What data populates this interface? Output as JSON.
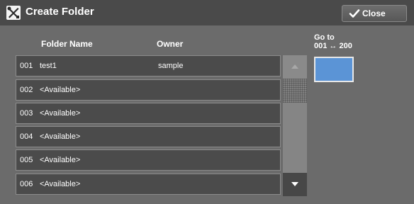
{
  "window": {
    "title": "Create Folder",
    "close_label": "Close",
    "icon": "tools-icon"
  },
  "table": {
    "headers": {
      "folder_name": "Folder Name",
      "owner": "Owner"
    },
    "rows": [
      {
        "number": "001",
        "name": "test1",
        "owner": "sample"
      },
      {
        "number": "002",
        "name": "<Available>",
        "owner": ""
      },
      {
        "number": "003",
        "name": "<Available>",
        "owner": ""
      },
      {
        "number": "004",
        "name": "<Available>",
        "owner": ""
      },
      {
        "number": "005",
        "name": "<Available>",
        "owner": ""
      },
      {
        "number": "006",
        "name": "<Available>",
        "owner": ""
      }
    ]
  },
  "goto": {
    "label_line1": "Go to",
    "label_line2": "001 ↔ 200"
  },
  "colors": {
    "background": "#6b6b6b",
    "titlebar": "#4a4a4a",
    "row": "#4b4b4b",
    "goto_button": "#5b94d6"
  }
}
